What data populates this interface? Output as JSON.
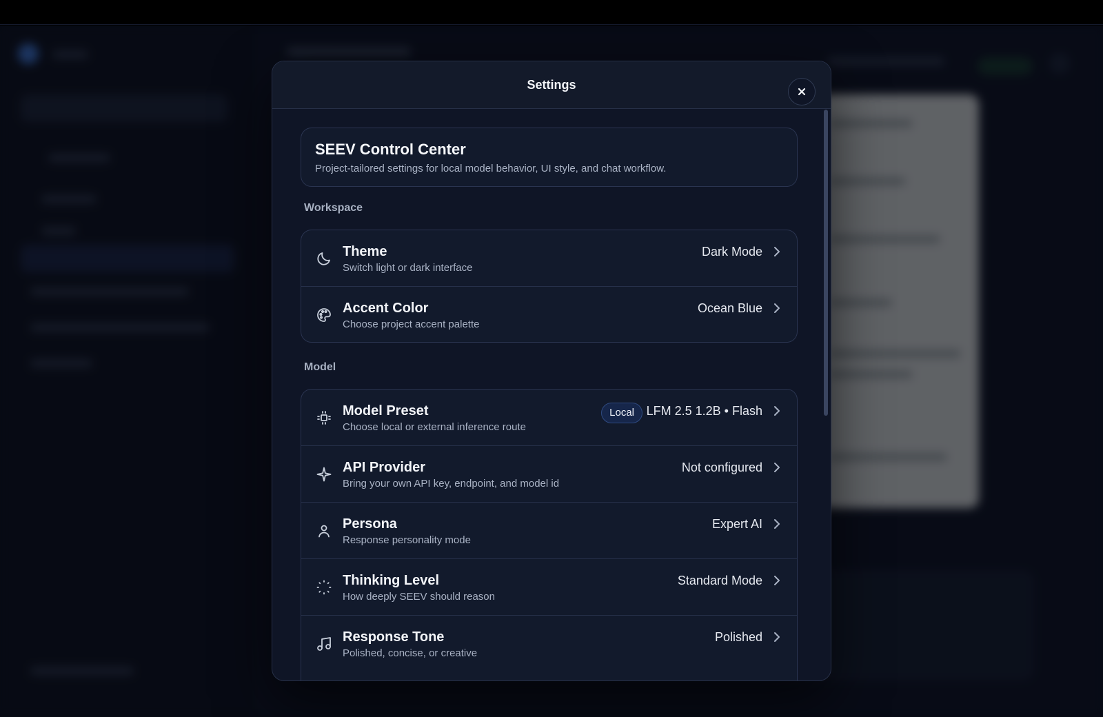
{
  "modal": {
    "title": "Settings",
    "close_label": "×"
  },
  "hero": {
    "title": "SEEV Control Center",
    "subtitle": "Project-tailored settings for local model behavior, UI style, and chat workflow."
  },
  "sections": {
    "workspace": {
      "label": "Workspace",
      "items": [
        {
          "title": "Theme",
          "subtitle": "Switch light or dark interface",
          "value": "Dark Mode",
          "icon": "moon-icon"
        },
        {
          "title": "Accent Color",
          "subtitle": "Choose project accent palette",
          "value": "Ocean Blue",
          "icon": "palette-icon"
        }
      ]
    },
    "model": {
      "label": "Model",
      "items": [
        {
          "title": "Model Preset",
          "subtitle": "Choose local or external inference route",
          "value": "LFM 2.5 1.2B • Flash",
          "badge": "Local",
          "icon": "chip-icon"
        },
        {
          "title": "API Provider",
          "subtitle": "Bring your own API key, endpoint, and model id",
          "value": "Not configured",
          "icon": "sparkle-icon"
        },
        {
          "title": "Persona",
          "subtitle": "Response personality mode",
          "value": "Expert AI",
          "icon": "user-icon"
        },
        {
          "title": "Thinking Level",
          "subtitle": "How deeply SEEV should reason",
          "value": "Standard Mode",
          "icon": "loader-icon"
        },
        {
          "title": "Response Tone",
          "subtitle": "Polished, concise, or creative",
          "value": "Polished",
          "icon": "music-note-icon"
        }
      ]
    }
  },
  "colors": {
    "background": "#0b0f1a",
    "modal": "#0f1526",
    "card": "#121a2c",
    "border": "#2a3450",
    "text_primary": "#f2f4f8",
    "text_secondary": "#aab3c5",
    "badge_bg": "#16264a"
  }
}
